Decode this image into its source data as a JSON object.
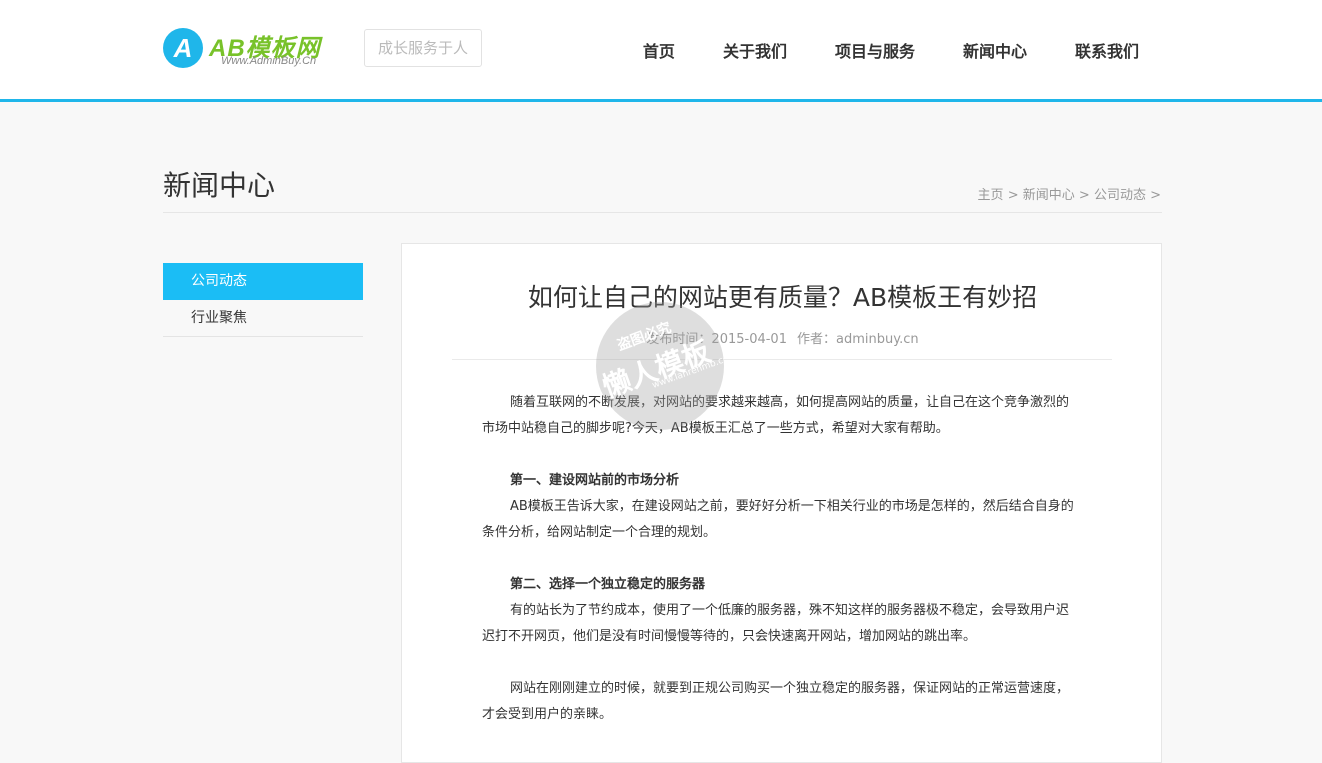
{
  "header": {
    "logo_badge": "A",
    "logo_title": "AB模板网",
    "logo_sub": "Www.AdminBuy.Cn",
    "slogan": "成长服务于人",
    "nav": [
      "首页",
      "关于我们",
      "项目与服务",
      "新闻中心",
      "联系我们"
    ]
  },
  "page": {
    "title": "新闻中心",
    "breadcrumb": [
      "主页",
      "新闻中心",
      "公司动态"
    ],
    "breadcrumb_sep": ">"
  },
  "sidebar": {
    "items": [
      "公司动态",
      "行业聚焦"
    ]
  },
  "article": {
    "title": "如何让自己的网站更有质量？AB模板王有妙招",
    "date_label": "发布时间：",
    "date": "2015-04-01",
    "author_label": "作者：",
    "author": "adminbuy.cn",
    "paragraphs": [
      "随着互联网的不断发展，对网站的要求越来越高，如何提高网站的质量，让自己在这个竞争激烈的市场中站稳自己的脚步呢?今天，AB模板王汇总了一些方式，希望对大家有帮助。",
      "第一、建设网站前的市场分析",
      "AB模板王告诉大家，在建设网站之前，要好好分析一下相关行业的市场是怎样的，然后结合自身的条件分析，给网站制定一个合理的规划。",
      "第二、选择一个独立稳定的服务器",
      "有的站长为了节约成本，使用了一个低廉的服务器，殊不知这样的服务器极不稳定，会导致用户迟迟打不开网页，他们是没有时间慢慢等待的，只会快速离开网站，增加网站的跳出率。",
      "网站在刚刚建立的时候，就要到正规公司购买一个独立稳定的服务器，保证网站的正常运营速度，才会受到用户的亲睐。"
    ]
  },
  "watermark": {
    "line1": "盗图必究",
    "line2": "懒人模板",
    "line3": "www.lanrenmb.com"
  },
  "colors": {
    "accent": "#1fb6ea",
    "sidebar_active": "#1bbdf5",
    "logo_green": "#78c22a"
  }
}
